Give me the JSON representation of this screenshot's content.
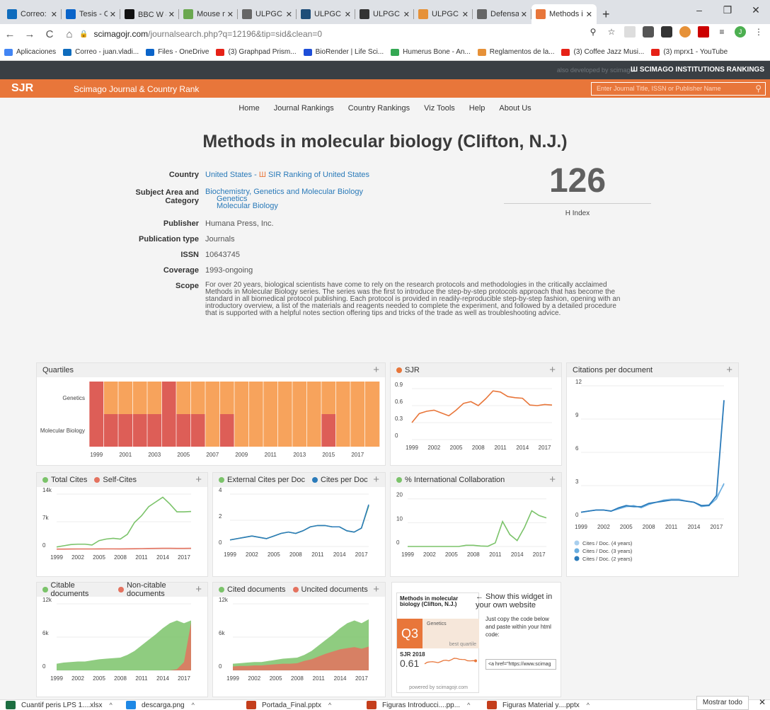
{
  "browser": {
    "tabs": [
      {
        "title": "Correo: DE",
        "icon": "outlook-icon",
        "color": "#0f6cbd"
      },
      {
        "title": "Tesis - One",
        "icon": "onedrive-icon",
        "color": "#0a64c9"
      },
      {
        "title": "BBC W ◀",
        "icon": "bbc-icon",
        "color": "#111"
      },
      {
        "title": "Mouse mo",
        "icon": "mouse-icon",
        "color": "#6aa84f"
      },
      {
        "title": "ULPGC - E",
        "icon": "ulpgc-icon",
        "color": "#666"
      },
      {
        "title": "ULPGC - N",
        "icon": "ulpgc-icon",
        "color": "#1f4e79"
      },
      {
        "title": "ULPGC - A",
        "icon": "ulpgc-icon",
        "color": "#333"
      },
      {
        "title": "ULPGC - C",
        "icon": "ulpgc-icon",
        "color": "#e69138"
      },
      {
        "title": "Defensa d",
        "icon": "globe-icon",
        "color": "#666"
      },
      {
        "title": "Methods i",
        "icon": "sjr-icon",
        "color": "#e8763a"
      }
    ],
    "url_host": "scimagojr.com",
    "url_path": "/journalsearch.php?q=12196&tip=sid&clean=0",
    "bookmarks": [
      {
        "label": "Aplicaciones",
        "color": "#4285f4"
      },
      {
        "label": "Correo - juan.vladi...",
        "color": "#0f6cbd"
      },
      {
        "label": "Files - OneDrive",
        "color": "#0a64c9"
      },
      {
        "label": "(3) Graphpad Prism...",
        "color": "#e62117"
      },
      {
        "label": "BioRender | Life Sci...",
        "color": "#1d4ed8"
      },
      {
        "label": "Humerus Bone - An...",
        "color": "#34a853"
      },
      {
        "label": "Reglamentos de la...",
        "color": "#e69138"
      },
      {
        "label": "(3) Coffee Jazz Musi...",
        "color": "#e62117"
      },
      {
        "label": "(3) mprx1 - YouTube",
        "color": "#e62117"
      }
    ],
    "profile_initial": "J"
  },
  "site": {
    "also_dev": "also developed by scimago:",
    "sir_label": "SCIMAGO INSTITUTIONS RANKINGS",
    "logo": "SJR",
    "subtitle": "Scimago Journal & Country Rank",
    "search_placeholder": "Enter Journal Title, ISSN or Publisher Name",
    "menu": [
      "Home",
      "Journal Rankings",
      "Country Rankings",
      "Viz Tools",
      "Help",
      "About Us"
    ]
  },
  "journal": {
    "title": "Methods in molecular biology (Clifton, N.J.)",
    "country_label": "Country",
    "country": "United States",
    "country_sep": " - ",
    "sir_ranking": "SIR Ranking of United States",
    "subject_label": "Subject Area and Category",
    "subject_area": "Biochemistry, Genetics and Molecular Biology",
    "categories": [
      "Genetics",
      "Molecular Biology"
    ],
    "publisher_label": "Publisher",
    "publisher": "Humana Press, Inc.",
    "pubtype_label": "Publication type",
    "pubtype": "Journals",
    "issn_label": "ISSN",
    "issn": "10643745",
    "coverage_label": "Coverage",
    "coverage": "1993-ongoing",
    "scope_label": "Scope",
    "scope": "For over 20 years, biological scientists have come to rely on the research protocols and methodologies in the critically acclaimed Methods in Molecular Biology series. The series was the first to introduce the step-by-step protocols approach that has become the standard in all biomedical protocol publishing. Each protocol is provided in readily-reproducible step-by-step fashion, opening with an introductory overview, a list of the materials and reagents needed to complete the experiment, and followed by a detailed procedure that is supported with a helpful notes section offering tips and tricks of the trade as well as troubleshooting advice.",
    "h_index": "126",
    "h_label": "H Index"
  },
  "cards": {
    "quartiles": "Quartiles",
    "sjr": "SJR",
    "cpd": "Citations per document",
    "total_cites": "Total Cites",
    "self_cites": "Self-Cites",
    "ext_cites": "External Cites per Doc",
    "cites_per_doc": "Cites per Doc",
    "intl": "% International Collaboration",
    "citable": "Citable documents",
    "noncitable": "Non-citable documents",
    "cited": "Cited documents",
    "uncited": "Uncited documents",
    "plus": "+"
  },
  "widget": {
    "title": "Methods in molecular biology (Clifton, N.J.)",
    "quartile": "Q3",
    "category": "Genetics",
    "best": "best quartile",
    "sjr_year": "SJR 2018",
    "sjr_value": "0.61",
    "powered": "powered by scimagojr.com",
    "arrow_text": "← Show this widget in your own website",
    "copy_text": "Just copy the code below and paste within your html code:",
    "code": "<a href=\"https://www.scimag"
  },
  "downloads": {
    "items": [
      {
        "name": "Cuantif peris LPS 1....xlsx",
        "color": "#1d6f42"
      },
      {
        "name": "descarga.png",
        "color": "#1e88e5"
      },
      {
        "name": "Portada_Final.pptx",
        "color": "#c43e1c"
      },
      {
        "name": "Figuras Introducci....pp...",
        "color": "#c43e1c"
      },
      {
        "name": "Figuras Material y....pptx",
        "color": "#c43e1c"
      }
    ],
    "show_all": "Mostrar todo"
  },
  "colors": {
    "q1": "#8fc970",
    "q2": "#f5c258",
    "q3": "#f7a35c",
    "q4": "#dd5e57",
    "orange": "#e8763a",
    "blue": "#2b7bba",
    "green": "#7bc36a",
    "red": "#e4725f"
  },
  "chart_data": [
    {
      "type": "heatmap",
      "title": "Quartiles",
      "rows": [
        "Genetics",
        "Molecular Biology"
      ],
      "years": [
        1999,
        2000,
        2001,
        2002,
        2003,
        2004,
        2005,
        2006,
        2007,
        2008,
        2009,
        2010,
        2011,
        2012,
        2013,
        2014,
        2015,
        2016,
        2017,
        2018
      ],
      "values": [
        [
          "Q4",
          "Q3",
          "Q3",
          "Q3",
          "Q3",
          "Q4",
          "Q3",
          "Q3",
          "Q3",
          "Q3",
          "Q3",
          "Q3",
          "Q3",
          "Q3",
          "Q3",
          "Q3",
          "Q3",
          "Q3",
          "Q3",
          "Q3"
        ],
        [
          "Q4",
          "Q4",
          "Q4",
          "Q4",
          "Q4",
          "Q4",
          "Q4",
          "Q4",
          "Q3",
          "Q4",
          "Q3",
          "Q3",
          "Q3",
          "Q3",
          "Q3",
          "Q3",
          "Q4",
          "Q3",
          "Q3",
          "Q3"
        ]
      ],
      "xticks": [
        "1999",
        "2001",
        "2003",
        "2005",
        "2007",
        "2009",
        "2011",
        "2013",
        "2015",
        "2017"
      ]
    },
    {
      "type": "line",
      "title": "SJR",
      "x": [
        1999,
        2000,
        2001,
        2002,
        2003,
        2004,
        2005,
        2006,
        2007,
        2008,
        2009,
        2010,
        2011,
        2012,
        2013,
        2014,
        2015,
        2016,
        2017,
        2018
      ],
      "series": [
        {
          "name": "SJR",
          "values": [
            0.3,
            0.46,
            0.5,
            0.52,
            0.47,
            0.42,
            0.52,
            0.64,
            0.67,
            0.6,
            0.72,
            0.86,
            0.84,
            0.76,
            0.74,
            0.73,
            0.61,
            0.6,
            0.62,
            0.61
          ]
        }
      ],
      "yticks": [
        "0",
        "0.3",
        "0.6",
        "0.9"
      ],
      "ylim": [
        0,
        1
      ],
      "xticks": [
        "1999",
        "2002",
        "2005",
        "2008",
        "2011",
        "2014",
        "2017"
      ]
    },
    {
      "type": "line",
      "title": "Citations per document",
      "x": [
        1999,
        2000,
        2001,
        2002,
        2003,
        2004,
        2005,
        2006,
        2007,
        2008,
        2009,
        2010,
        2011,
        2012,
        2013,
        2014,
        2015,
        2016,
        2017,
        2018
      ],
      "series": [
        {
          "name": "Cites / Doc. (4 years)",
          "values": [
            0.6,
            0.7,
            0.8,
            0.8,
            0.7,
            0.9,
            1.1,
            1.1,
            1.1,
            1.3,
            1.5,
            1.7,
            1.8,
            1.8,
            1.6,
            1.5,
            1.2,
            1.3,
            2.0,
            3.1
          ]
        },
        {
          "name": "Cites / Doc. (3 years)",
          "values": [
            0.6,
            0.7,
            0.8,
            0.8,
            0.7,
            0.9,
            1.1,
            1.2,
            1.0,
            1.3,
            1.5,
            1.7,
            1.7,
            1.7,
            1.6,
            1.5,
            1.1,
            1.2,
            1.8,
            3.2
          ]
        },
        {
          "name": "Cites / Doc. (2 years)",
          "values": [
            0.6,
            0.7,
            0.8,
            0.8,
            0.7,
            1.0,
            1.2,
            1.1,
            1.1,
            1.4,
            1.5,
            1.6,
            1.7,
            1.7,
            1.6,
            1.5,
            1.2,
            1.2,
            2.1,
            10.7
          ]
        }
      ],
      "yticks": [
        "0",
        "3",
        "6",
        "9",
        "12"
      ],
      "ylim": [
        0,
        12
      ],
      "xticks": [
        "1999",
        "2002",
        "2005",
        "2008",
        "2011",
        "2014",
        "2017"
      ]
    },
    {
      "type": "line",
      "title": "Total Cites",
      "x": [
        1999,
        2000,
        2001,
        2002,
        2003,
        2004,
        2005,
        2006,
        2007,
        2008,
        2009,
        2010,
        2011,
        2012,
        2013,
        2014,
        2015,
        2016,
        2017,
        2018
      ],
      "series": [
        {
          "name": "Total Cites",
          "values": [
            600,
            900,
            1200,
            1300,
            1300,
            1100,
            2200,
            2600,
            2800,
            2600,
            3800,
            6800,
            8500,
            10800,
            12000,
            13200,
            11500,
            9500,
            9500,
            9600
          ]
        },
        {
          "name": "Self-Cites",
          "values": [
            50,
            60,
            80,
            90,
            90,
            90,
            100,
            110,
            110,
            100,
            120,
            150,
            180,
            220,
            240,
            260,
            250,
            230,
            240,
            250
          ]
        }
      ],
      "yticks": [
        "0",
        "7k",
        "14k"
      ],
      "ylim": [
        0,
        14000
      ],
      "xticks": [
        "1999",
        "2002",
        "2005",
        "2008",
        "2011",
        "2014",
        "2017"
      ]
    },
    {
      "type": "line",
      "title": "External Cites per Doc / Cites per Doc",
      "x": [
        1999,
        2000,
        2001,
        2002,
        2003,
        2004,
        2005,
        2006,
        2007,
        2008,
        2009,
        2010,
        2011,
        2012,
        2013,
        2014,
        2015,
        2016,
        2017,
        2018
      ],
      "series": [
        {
          "name": "External Cites per Doc",
          "values": [
            0.5,
            0.6,
            0.7,
            0.8,
            0.7,
            0.6,
            0.8,
            1.0,
            1.1,
            1.0,
            1.2,
            1.5,
            1.6,
            1.6,
            1.5,
            1.5,
            1.2,
            1.1,
            1.4,
            3.1
          ]
        },
        {
          "name": "Cites per Doc",
          "values": [
            0.5,
            0.6,
            0.7,
            0.8,
            0.7,
            0.6,
            0.8,
            1.0,
            1.1,
            1.0,
            1.2,
            1.5,
            1.6,
            1.6,
            1.5,
            1.5,
            1.2,
            1.1,
            1.4,
            3.2
          ]
        }
      ],
      "yticks": [
        "0",
        "2",
        "4"
      ],
      "ylim": [
        0,
        4
      ],
      "xticks": [
        "1999",
        "2002",
        "2005",
        "2008",
        "2011",
        "2014",
        "2017"
      ]
    },
    {
      "type": "line",
      "title": "% International Collaboration",
      "x": [
        1999,
        2000,
        2001,
        2002,
        2003,
        2004,
        2005,
        2006,
        2007,
        2008,
        2009,
        2010,
        2011,
        2012,
        2013,
        2014,
        2015,
        2016,
        2017,
        2018
      ],
      "series": [
        {
          "name": "% International Collaboration",
          "values": [
            0,
            0,
            0,
            0,
            0,
            0,
            0,
            0,
            0.5,
            0.5,
            0.2,
            0.1,
            1.5,
            10.5,
            5,
            2.5,
            8,
            15,
            13,
            12,
            8,
            2,
            2.5,
            19,
            19.2
          ]
        }
      ],
      "yticks": [
        "0",
        "10",
        "20"
      ],
      "ylim": [
        0,
        22
      ],
      "xticks": [
        "1999",
        "2002",
        "2005",
        "2008",
        "2011",
        "2014",
        "2017"
      ]
    },
    {
      "type": "area",
      "title": "Citable documents / Non-citable documents",
      "x": [
        1999,
        2000,
        2001,
        2002,
        2003,
        2004,
        2005,
        2006,
        2007,
        2008,
        2009,
        2010,
        2011,
        2012,
        2013,
        2014,
        2015,
        2016,
        2017,
        2018
      ],
      "series": [
        {
          "name": "Citable documents",
          "values": [
            1200,
            1400,
            1500,
            1600,
            1600,
            1800,
            2000,
            2100,
            2200,
            2300,
            2800,
            3500,
            4500,
            5500,
            6500,
            7600,
            8500,
            9000,
            8500,
            9000
          ]
        },
        {
          "name": "Non-citable documents",
          "values": [
            0,
            0,
            0,
            0,
            0,
            0,
            0,
            0,
            0,
            0,
            0,
            0,
            0,
            0,
            0,
            0,
            0,
            200,
            1500,
            8600
          ]
        }
      ],
      "yticks": [
        "0",
        "6k",
        "12k"
      ],
      "ylim": [
        0,
        12000
      ],
      "xticks": [
        "1999",
        "2002",
        "2005",
        "2008",
        "2011",
        "2014",
        "2017"
      ]
    },
    {
      "type": "area",
      "title": "Cited documents / Uncited documents",
      "x": [
        1999,
        2000,
        2001,
        2002,
        2003,
        2004,
        2005,
        2006,
        2007,
        2008,
        2009,
        2010,
        2011,
        2012,
        2013,
        2014,
        2015,
        2016,
        2017,
        2018
      ],
      "series": [
        {
          "name": "Cited documents",
          "values": [
            1200,
            1300,
            1400,
            1500,
            1500,
            1700,
            1900,
            2100,
            2200,
            2300,
            2800,
            3500,
            4500,
            5500,
            6500,
            7600,
            8500,
            9000,
            8500,
            9200
          ]
        },
        {
          "name": "Uncited documents",
          "values": [
            700,
            800,
            800,
            900,
            900,
            1000,
            1100,
            1200,
            1200,
            1300,
            1700,
            2000,
            2500,
            3000,
            3400,
            3800,
            4000,
            4200,
            3900,
            4300
          ]
        }
      ],
      "yticks": [
        "0",
        "6k",
        "12k"
      ],
      "ylim": [
        0,
        12000
      ],
      "xticks": [
        "1999",
        "2002",
        "2005",
        "2008",
        "2011",
        "2014",
        "2017"
      ]
    }
  ]
}
